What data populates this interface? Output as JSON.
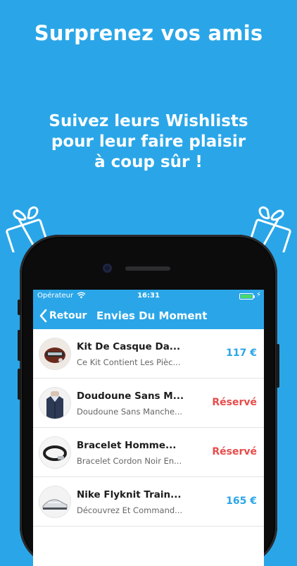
{
  "headline": "Surprenez vos amis",
  "tagline": [
    "Suivez leurs Wishlists",
    "pour leur faire plaisir",
    "à coup sûr !"
  ],
  "colors": {
    "brand": "#2aa6e8",
    "reserved": "#e84b4b",
    "battery": "#4cd964"
  },
  "status_bar": {
    "carrier": "Opérateur",
    "time": "16:31"
  },
  "navbar": {
    "back_label": "Retour",
    "title": "Envies Du Moment"
  },
  "items": [
    {
      "title": "Kit De Casque Da...",
      "subtitle": "Ce Kit Contient Les Pièc...",
      "value": "117 €",
      "status": "price",
      "icon": "helmet-kit-thumbnail"
    },
    {
      "title": "Doudoune Sans M...",
      "subtitle": "Doudoune Sans Manche...",
      "value": "Réservé",
      "status": "reserved",
      "icon": "vest-thumbnail"
    },
    {
      "title": "Bracelet Homme...",
      "subtitle": "Bracelet Cordon Noir En...",
      "value": "Réservé",
      "status": "reserved",
      "icon": "bracelet-thumbnail"
    },
    {
      "title": "Nike Flyknit Train...",
      "subtitle": "Découvrez Et Command...",
      "value": "165 €",
      "status": "price",
      "icon": "sneaker-thumbnail"
    }
  ]
}
